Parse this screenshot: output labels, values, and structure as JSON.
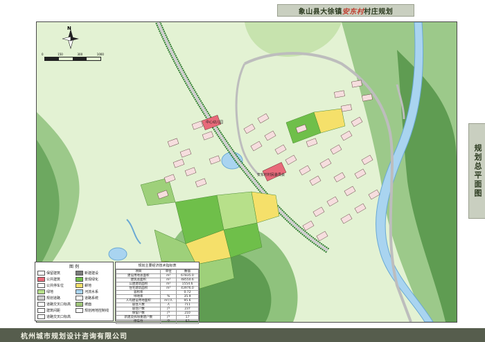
{
  "header": {
    "prefix": "象山县大徐镇",
    "village": "安东村",
    "suffix": "村庄规划"
  },
  "side_label": "规划总平面图",
  "footer": "杭州城市规划设计咨询有限公司",
  "map": {
    "north_label": "N",
    "scale_ticks": [
      "0",
      "150",
      "300",
      "1000"
    ],
    "site_labels": [
      "中心幼儿园",
      "安东村村民委员会"
    ]
  },
  "legend": {
    "title": "图  例",
    "items": [
      {
        "label": "保留建筑",
        "color": "#ffffff"
      },
      {
        "label": "新建建设",
        "color": "#7a7a7a"
      },
      {
        "label": "公共建筑",
        "color": "#e86a7a"
      },
      {
        "label": "景观绿化",
        "color": "#6fbf4a"
      },
      {
        "label": "公共停车位",
        "color": "#ffffff"
      },
      {
        "label": "耕地",
        "color": "#f5e06a"
      },
      {
        "label": "绿地",
        "color": "#b7e08a"
      },
      {
        "label": "河流水系",
        "color": "#a9d4f0"
      },
      {
        "label": "规划道路",
        "color": "#cccccc"
      },
      {
        "label": "道路系统",
        "color": "#ffffff"
      },
      {
        "label": "道路交叉口标高",
        "color": "#ffffff"
      },
      {
        "label": "坡面",
        "color": "#9fc67a"
      },
      {
        "label": "建筑间距",
        "color": "#ffffff"
      },
      {
        "label": "规划用地控制线",
        "color": "#ffffff"
      },
      {
        "label": "道路交叉口标高",
        "color": "#ffffff"
      }
    ]
  },
  "stats": {
    "title": "规划主要经济技术指标表",
    "headers": [
      "项目",
      "单位",
      "数值"
    ],
    "rows": [
      [
        "建设用地总面积",
        "m²",
        "67835.0"
      ],
      [
        "建筑总面积",
        "m²",
        "48550.6"
      ],
      [
        "公建建筑面积",
        "m²",
        "1554.6"
      ],
      [
        "住宅建筑面积",
        "m²",
        "43976.0"
      ],
      [
        "容积率",
        "",
        "0.72"
      ],
      [
        "绿地率",
        "%",
        "35.9"
      ],
      [
        "人均建设用地面积",
        "m²/人",
        "95.6"
      ],
      [
        "居住人数",
        "人",
        "711"
      ],
      [
        "居住户数",
        "户",
        "237"
      ],
      [
        "保留户数",
        "户",
        "210"
      ],
      [
        "新建及拆除重建户数",
        "户",
        "17"
      ],
      [
        "停车位",
        "个",
        "67"
      ]
    ]
  }
}
